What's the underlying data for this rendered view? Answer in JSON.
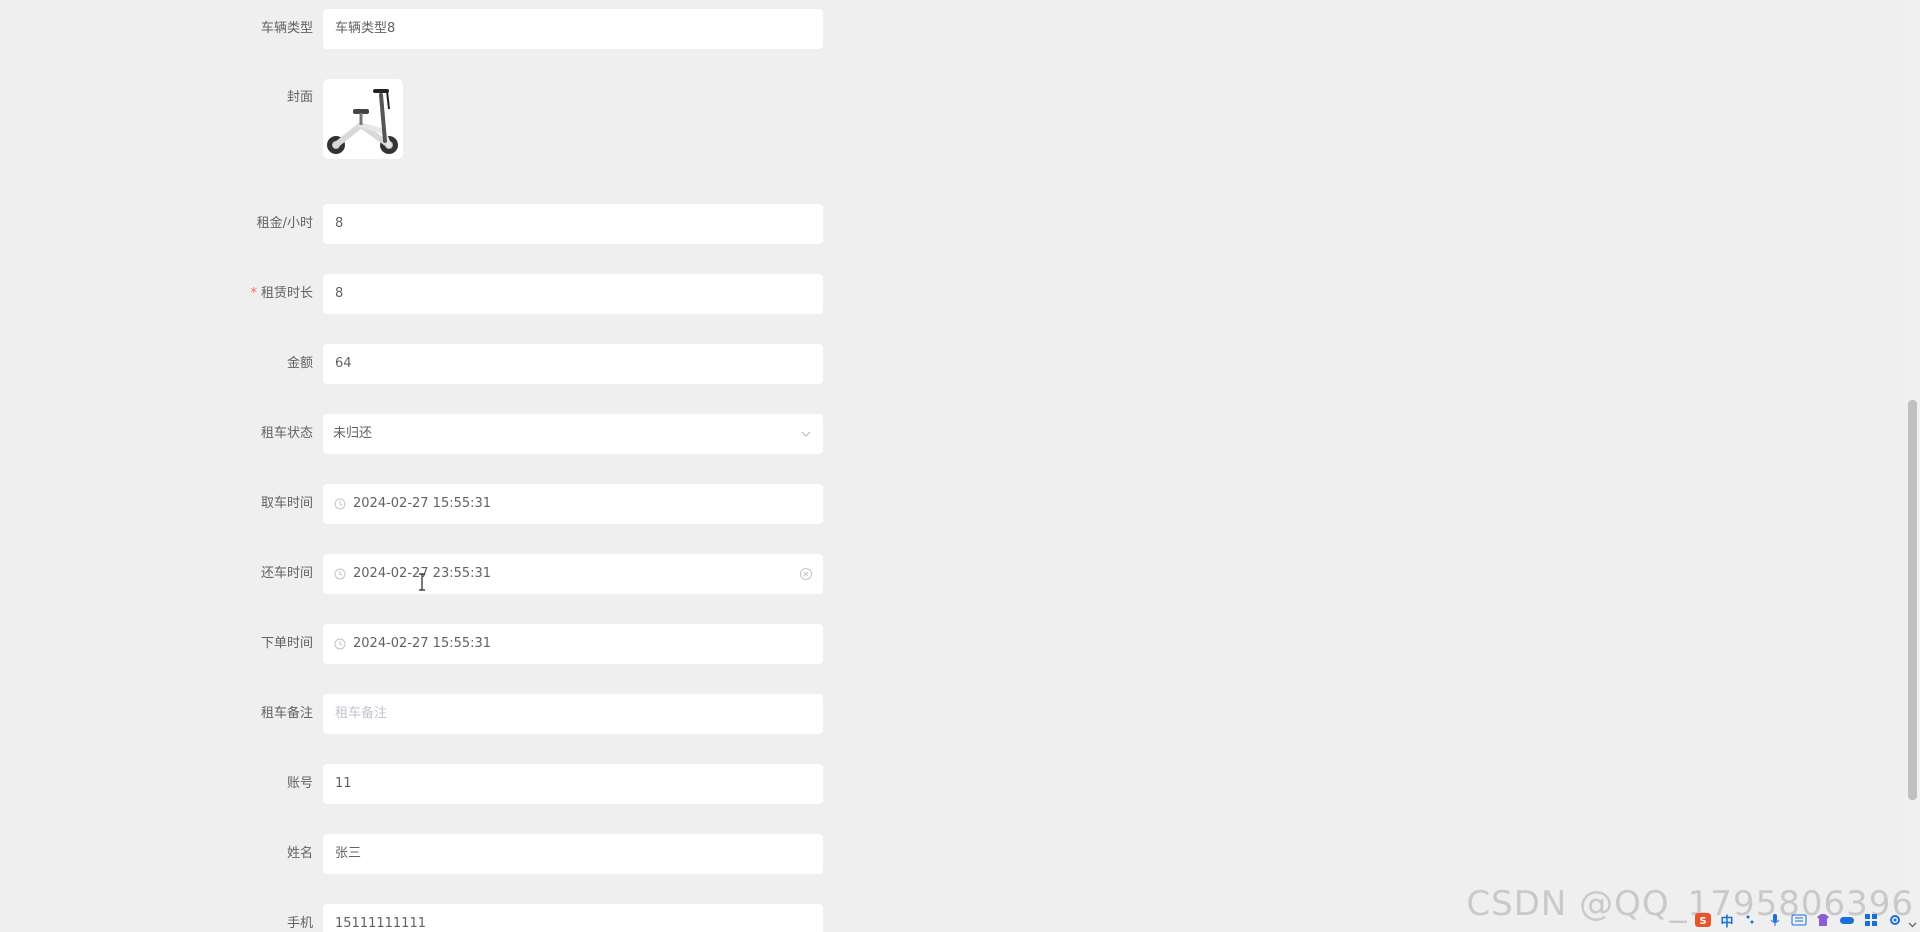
{
  "form": {
    "vehicle_type": {
      "label": "车辆类型",
      "value": "车辆类型8"
    },
    "cover": {
      "label": "封面"
    },
    "rent_per_hour": {
      "label": "租金/小时",
      "value": "8"
    },
    "rent_duration": {
      "label": "租赁时长",
      "required_mark": "*",
      "value": "8"
    },
    "amount": {
      "label": "金额",
      "value": "64"
    },
    "rental_status": {
      "label": "租车状态",
      "value": "未归还"
    },
    "pickup_time": {
      "label": "取车时间",
      "value": "2024-02-27 15:55:31"
    },
    "return_time": {
      "label": "还车时间",
      "value": "2024-02-27 23:55:31"
    },
    "order_time": {
      "label": "下单时间",
      "value": "2024-02-27 15:55:31"
    },
    "rental_note": {
      "label": "租车备注",
      "placeholder": "租车备注"
    },
    "account": {
      "label": "账号",
      "value": "11"
    },
    "name": {
      "label": "姓名",
      "value": "张三"
    },
    "phone": {
      "label": "手机",
      "value": "15111111111"
    }
  },
  "watermark": "CSDN @QQ_1795806396",
  "ime": {
    "lang_label": "中",
    "icons": [
      "punctuation-icon",
      "microphone-icon",
      "keyboard-icon",
      "skin-icon",
      "game-icon",
      "apps-icon",
      "settings-icon"
    ]
  },
  "colors": {
    "background": "#efefef",
    "input_bg": "#ffffff",
    "label_text": "#606266",
    "placeholder": "#c0c4cc",
    "required": "#f56c6c"
  }
}
